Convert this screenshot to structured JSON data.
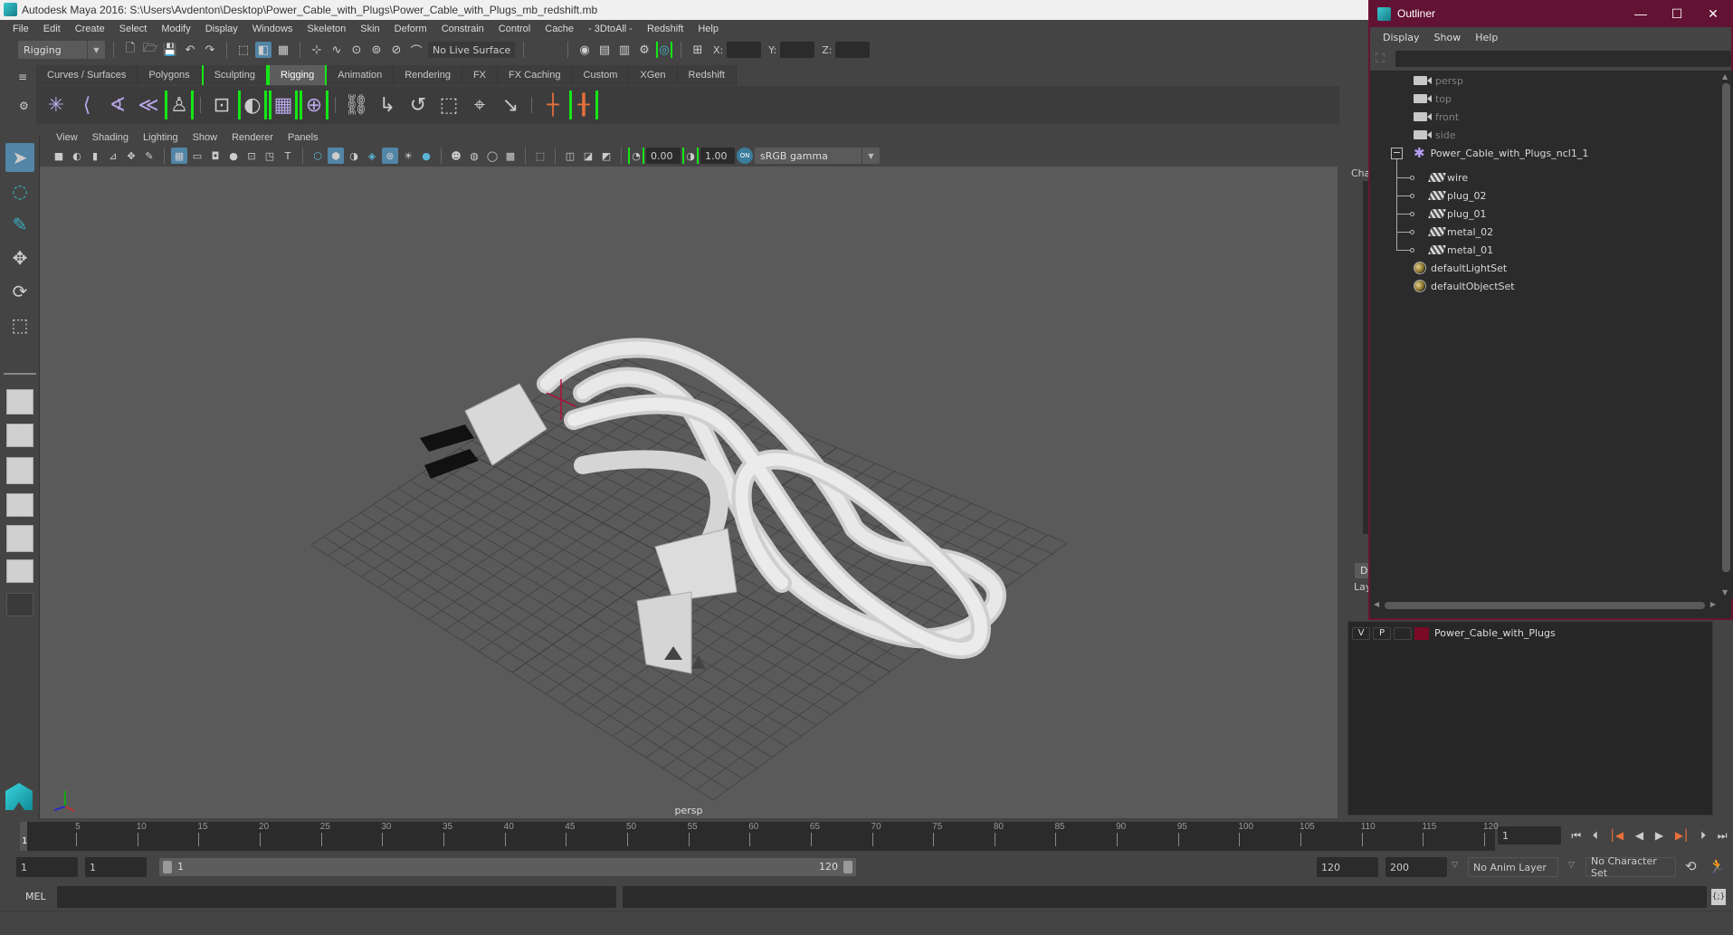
{
  "window": {
    "title": "Autodesk Maya 2016: S:\\Users\\Avdenton\\Desktop\\Power_Cable_with_Plugs\\Power_Cable_with_Plugs_mb_redshift.mb"
  },
  "menubar": [
    "File",
    "Edit",
    "Create",
    "Select",
    "Modify",
    "Display",
    "Windows",
    "Skeleton",
    "Skin",
    "Deform",
    "Constrain",
    "Control",
    "Cache",
    "- 3DtoAll -",
    "Redshift",
    "Help"
  ],
  "statusline": {
    "menuset": "Rigging",
    "live_surface": "No Live Surface",
    "x_label": "X:",
    "y_label": "Y:",
    "z_label": "Z:",
    "x_value": "",
    "y_value": "",
    "z_value": ""
  },
  "shelf": {
    "tabs": [
      {
        "label": "Curves / Surfaces",
        "active": false
      },
      {
        "label": "Polygons",
        "active": false
      },
      {
        "label": "Sculpting",
        "active": false
      },
      {
        "label": "Rigging",
        "active": true
      },
      {
        "label": "Animation",
        "active": false
      },
      {
        "label": "Rendering",
        "active": false
      },
      {
        "label": "FX",
        "active": false
      },
      {
        "label": "FX Caching",
        "active": false
      },
      {
        "label": "Custom",
        "active": false
      },
      {
        "label": "XGen",
        "active": false
      },
      {
        "label": "Redshift",
        "active": false
      }
    ],
    "icons": [
      "joint-tool-icon",
      "ik-handle-icon",
      "ik-spline-icon",
      "insert-joint-icon",
      "quick-rig-icon",
      "bind-skin-icon",
      "paint-weights-icon",
      "lattice-icon",
      "cluster-icon",
      "parent-constraint-icon",
      "point-constraint-icon",
      "orient-constraint-icon",
      "scale-constraint-icon",
      "aim-constraint-icon",
      "pole-vector-icon",
      "locator-icon",
      "locator-constraint-icon"
    ]
  },
  "viewport": {
    "menus": [
      "View",
      "Shading",
      "Lighting",
      "Show",
      "Renderer",
      "Panels"
    ],
    "exposure": "0.00",
    "gamma": "1.00",
    "color_space": "sRGB gamma",
    "camera_label": "persp"
  },
  "right_panel": {
    "channel_box_tab": "Cha",
    "display_tab": "Dis",
    "layers_label": "Lay"
  },
  "outliner": {
    "title": "Outliner",
    "menus": [
      "Display",
      "Show",
      "Help"
    ],
    "cameras": [
      "persp",
      "top",
      "front",
      "side"
    ],
    "group": "Power_Cable_with_Plugs_ncl1_1",
    "children": [
      "wire",
      "plug_02",
      "plug_01",
      "metal_02",
      "metal_01"
    ],
    "sets": [
      "defaultLightSet",
      "defaultObjectSet"
    ]
  },
  "layer_editor": {
    "layer": {
      "v": "V",
      "p": "P",
      "name": "Power_Cable_with_Plugs",
      "color": "#7a0a26"
    }
  },
  "timeline": {
    "ticks": [
      5,
      10,
      15,
      20,
      25,
      30,
      35,
      40,
      45,
      50,
      55,
      60,
      65,
      70,
      75,
      80,
      85,
      90,
      95,
      100,
      105,
      110,
      115,
      120
    ],
    "current_marker": "1",
    "current_frame": "1"
  },
  "range": {
    "start_frame": "1",
    "anim_start": "1",
    "slider_start": "1",
    "slider_end": "120",
    "anim_end": "120",
    "end_frame": "200",
    "anim_layer": "No Anim Layer",
    "character_set": "No Character Set"
  },
  "command": {
    "language": "MEL"
  },
  "colors": {
    "accent_blue": "#5285a6",
    "shelf_bracket_green": "#16e616",
    "outliner_titlebar": "#621232",
    "viewport_bg": "#5a5a5a"
  }
}
